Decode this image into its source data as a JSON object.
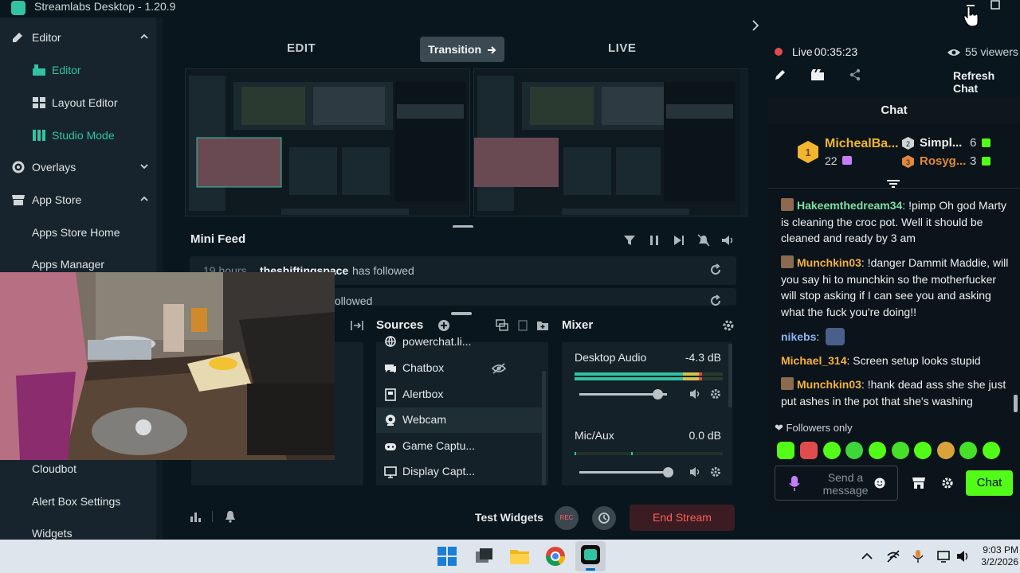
{
  "window": {
    "title": "Streamlabs Desktop - 1.20.9"
  },
  "sidebar": {
    "items": [
      {
        "label": "Editor",
        "icon": "editor-icon",
        "expanded": true
      },
      {
        "label": "Editor",
        "icon": "editor-sub-icon",
        "active": true
      },
      {
        "label": "Layout Editor",
        "icon": "layout-grid-icon"
      },
      {
        "label": "Studio Mode",
        "icon": "columns-icon",
        "active": true
      },
      {
        "label": "Overlays",
        "icon": "gear-palette-icon"
      },
      {
        "label": "App Store",
        "icon": "store-icon",
        "expanded": true
      },
      {
        "label": "Apps Store Home"
      },
      {
        "label": "Apps Manager"
      },
      {
        "label": "Cloudbot"
      },
      {
        "label": "Alert Box Settings"
      },
      {
        "label": "Widgets"
      }
    ]
  },
  "studio": {
    "edit_label": "EDIT",
    "transition_label": "Transition",
    "live_label": "LIVE"
  },
  "minifeed": {
    "title": "Mini Feed",
    "rows": [
      {
        "time": "19 hours",
        "user": "theshiftingspace",
        "action": "has followed"
      },
      {
        "time": "",
        "user": "",
        "action": "followed"
      }
    ]
  },
  "sources": {
    "title": "Sources",
    "items": [
      {
        "label": "powerchat.li...",
        "icon": "globe-icon"
      },
      {
        "label": "Chatbox",
        "icon": "chat-icon",
        "hidden": true
      },
      {
        "label": "Alertbox",
        "icon": "alert-icon"
      },
      {
        "label": "Webcam",
        "icon": "webcam-icon",
        "selected": true
      },
      {
        "label": "Game Captu...",
        "icon": "gamepad-icon"
      },
      {
        "label": "Display Capt...",
        "icon": "monitor-icon"
      }
    ]
  },
  "mixer": {
    "title": "Mixer",
    "channels": [
      {
        "name": "Desktop Audio",
        "db": "-4.3 dB",
        "level": 0.86,
        "volume": 0.78
      },
      {
        "name": "Mic/Aux",
        "db": "0.0 dB",
        "level": 0.0,
        "volume": 1.0
      }
    ]
  },
  "footer": {
    "test_widgets": "Test Widgets",
    "rec_label": "REC",
    "end_stream": "End Stream"
  },
  "chat": {
    "live_status": "Live",
    "live_time": "00:35:23",
    "viewers": "55 viewers",
    "refresh": "Refresh Chat",
    "header": "Chat",
    "leaderboard": {
      "first": {
        "rank": "1",
        "name": "MichealBa...",
        "count": "22"
      },
      "second": {
        "rank": "2",
        "name": "Simpl...",
        "count": "6"
      },
      "third": {
        "rank": "3",
        "name": "Rosyg...",
        "count": "3"
      }
    },
    "messages": [
      {
        "user": "Hakeemthedream34",
        "color": "#7ee0a4",
        "text": ": !pimp Oh god Marty is cleaning the croc pot. Well it should be cleaned and ready by 3 am"
      },
      {
        "user": "Munchkin03",
        "color": "#f7b040",
        "text": ": !danger Dammit Maddie, will you say hi to munchkin so the motherfucker will stop asking if I can see you and asking what the fuck you're doing!!"
      },
      {
        "user": "nikebs",
        "color": "#8ab4f8",
        "text": ":"
      },
      {
        "user": "Michael_314",
        "color": "#f7b040",
        "text": ": Screen setup looks stupid"
      },
      {
        "user": "Munchkin03",
        "color": "#f7b040",
        "text": ": !hank dead ass she she just put ashes in the pot that she's washing"
      }
    ],
    "followers_only": "Followers only",
    "placeholder": "Send a message",
    "send_label": "Chat"
  },
  "tray": {
    "time": "9:03 PM",
    "date": "3/2/2026"
  },
  "colors": {
    "accent": "#31c3a2",
    "bg": "#09161d",
    "panel": "#17242d",
    "end_stream_bg": "#3a1c22",
    "end_stream_text": "#ff5c5c",
    "chat_send": "#53fc18"
  }
}
